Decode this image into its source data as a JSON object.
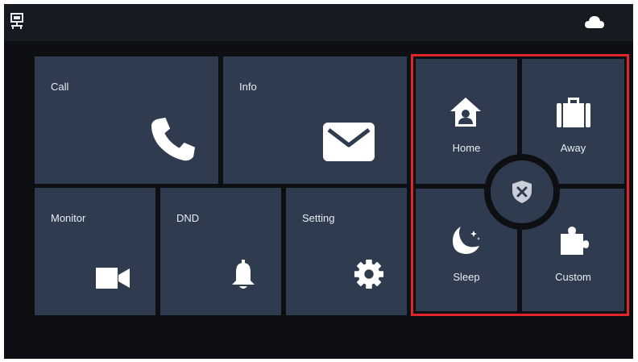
{
  "topbar": {
    "left_icon": "network-icon",
    "right_icon": "cloud-icon"
  },
  "tiles": {
    "call": {
      "label": "Call",
      "icon": "phone-icon"
    },
    "info": {
      "label": "Info",
      "icon": "envelope-icon"
    },
    "monitor": {
      "label": "Monitor",
      "icon": "video-camera-icon"
    },
    "dnd": {
      "label": "DND",
      "icon": "bell-icon"
    },
    "setting": {
      "label": "Setting",
      "icon": "gear-icon"
    }
  },
  "modes": {
    "home": {
      "label": "Home",
      "icon": "home-icon"
    },
    "away": {
      "label": "Away",
      "icon": "suitcase-icon"
    },
    "sleep": {
      "label": "Sleep",
      "icon": "moon-icon"
    },
    "custom": {
      "label": "Custom",
      "icon": "puzzle-icon"
    },
    "disarm_icon": "shield-x-icon"
  },
  "colors": {
    "background": "#0d0f13",
    "tile": "#2f3b4f",
    "text": "#e8ecf2",
    "highlight_border": "#e0252c"
  }
}
